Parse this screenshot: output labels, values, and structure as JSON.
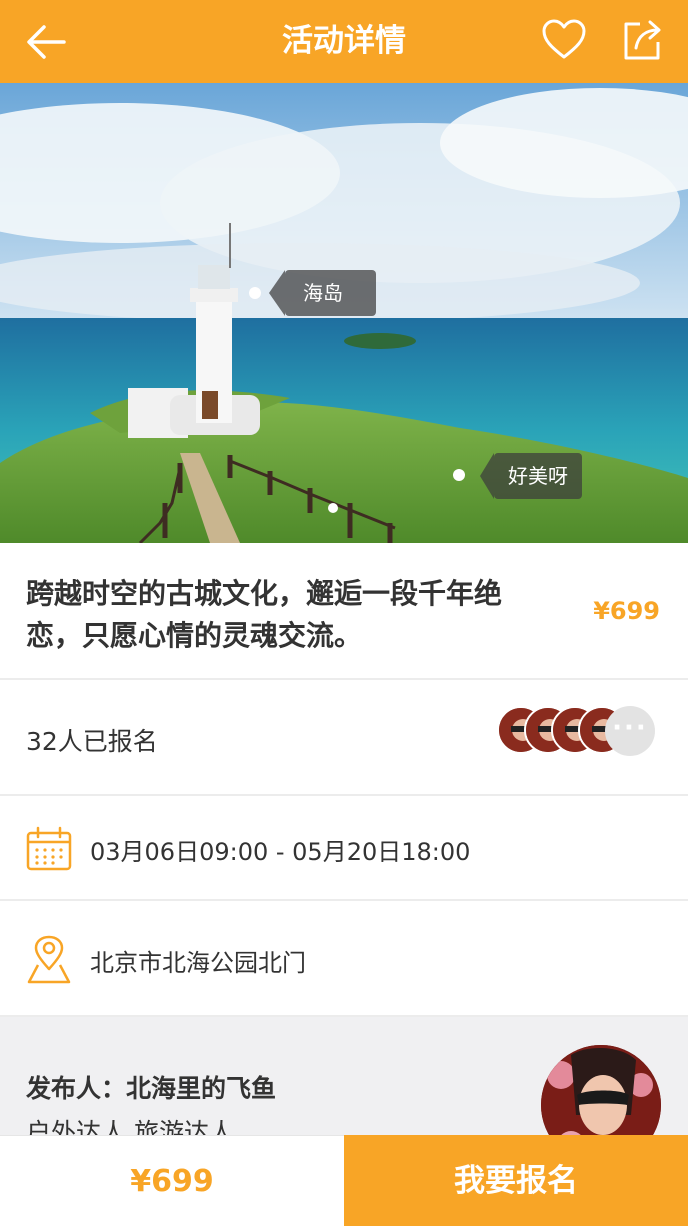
{
  "header": {
    "title": "活动详情",
    "back_icon": "arrow-left-icon",
    "favorite_icon": "heart-icon",
    "share_icon": "share-icon"
  },
  "hero": {
    "tags": [
      "海岛",
      "好美呀"
    ]
  },
  "activity": {
    "title": "跨越时空的古城文化，邂逅一段千年绝恋，只愿心情的灵魂交流。",
    "price": "¥699"
  },
  "signup": {
    "count_text": "32人已报名",
    "more_label": "···"
  },
  "schedule": {
    "icon": "calendar-icon",
    "time_range": "03月06日09:00 - 05月20日18:00"
  },
  "location": {
    "icon": "location-pin-icon",
    "address": "北京市北海公园北门"
  },
  "publisher": {
    "name_line": "发布人：北海里的飞鱼",
    "tags_line": "户外达人 旅游达人"
  },
  "bottom_bar": {
    "price": "¥699",
    "signup_button": "我要报名"
  },
  "colors": {
    "accent": "#f8a526",
    "divider": "#ececec",
    "publisher_bg": "#f0f0f2"
  }
}
